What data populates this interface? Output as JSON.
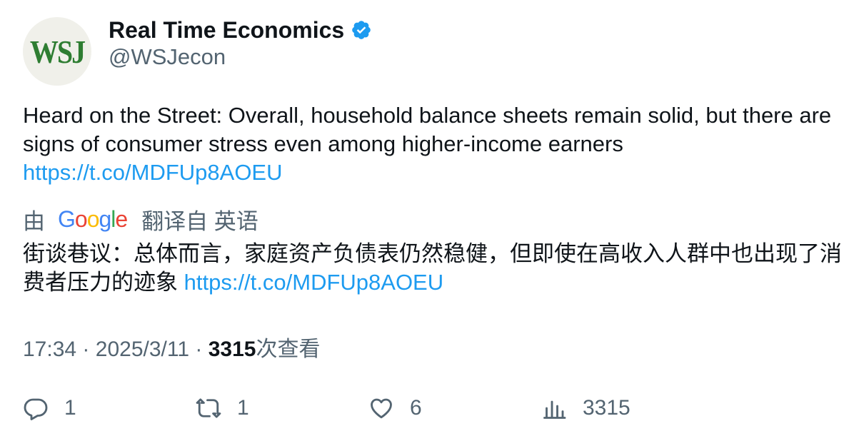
{
  "author": {
    "avatar_text": "WSJ",
    "display_name": "Real Time Economics",
    "handle": "@WSJecon",
    "verified": true
  },
  "tweet": {
    "text": "Heard on the Street: Overall, household balance sheets remain solid, but there are signs of consumer stress even among higher-income earners",
    "link": "https://t.co/MDFUp8AOEU"
  },
  "translation": {
    "prefix": "由",
    "provider": "Google",
    "suffix": "翻译自 英语",
    "text": "街谈巷议：总体而言，家庭资产负债表仍然稳健，但即使在高收入人群中也出现了消费者压力的迹象",
    "link": "https://t.co/MDFUp8AOEU"
  },
  "meta": {
    "time": "17:34",
    "separator": "·",
    "date": "2025/3/11",
    "views_count": "3315",
    "views_label": "次查看"
  },
  "actions": {
    "replies": "1",
    "retweets": "1",
    "likes": "6",
    "views": "3315"
  },
  "colors": {
    "link": "#1d9bf0",
    "secondary_text": "#536471",
    "verified_badge": "#1d9bf0",
    "avatar_logo": "#2e7d32"
  }
}
